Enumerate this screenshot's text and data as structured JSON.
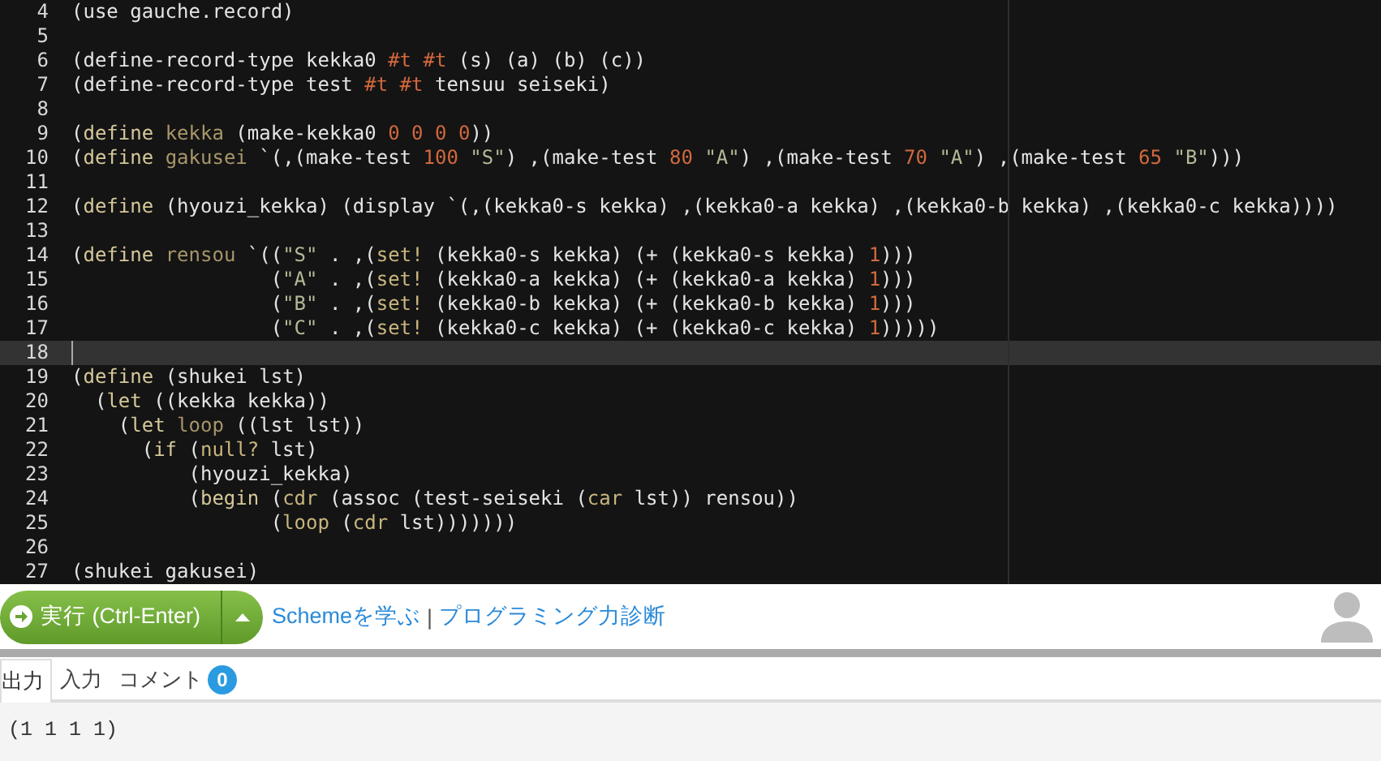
{
  "editor": {
    "lines": [
      {
        "number": "4",
        "active": false,
        "tokens": [
          {
            "text": "(use gauche.record)",
            "kind": "plain"
          }
        ]
      },
      {
        "number": "5",
        "active": false
      },
      {
        "number": "6",
        "active": false,
        "tokens": [
          {
            "text": "(define-record-type kekka0 ",
            "kind": "plain"
          },
          {
            "text": "#t #t",
            "kind": "number"
          },
          {
            "text": " (s) (a) (b) (c))",
            "kind": "plain"
          }
        ]
      },
      {
        "number": "7",
        "active": false,
        "tokens": [
          {
            "text": "(define-record-type test ",
            "kind": "plain"
          },
          {
            "text": "#t #t",
            "kind": "number"
          },
          {
            "text": " tensuu seiseki)",
            "kind": "plain"
          }
        ]
      },
      {
        "number": "8",
        "active": false
      },
      {
        "number": "9",
        "active": false,
        "tokens": [
          {
            "text": "(",
            "kind": "plain"
          },
          {
            "text": "define",
            "kind": "keyword"
          },
          {
            "text": " kekka",
            "kind": "name"
          },
          {
            "text": " (make-kekka0 ",
            "kind": "plain"
          },
          {
            "text": "0 0 0 0",
            "kind": "number"
          },
          {
            "text": "))",
            "kind": "plain"
          }
        ]
      },
      {
        "number": "10",
        "active": false,
        "tokens": [
          {
            "text": "(",
            "kind": "plain"
          },
          {
            "text": "define",
            "kind": "keyword"
          },
          {
            "text": " gakusei",
            "kind": "name"
          },
          {
            "text": " `(,(make-test ",
            "kind": "plain"
          },
          {
            "text": "100",
            "kind": "number"
          },
          {
            "text": " \"S\"",
            "kind": "string"
          },
          {
            "text": ") ,(make-test ",
            "kind": "plain"
          },
          {
            "text": "80",
            "kind": "number"
          },
          {
            "text": " \"A\"",
            "kind": "string"
          },
          {
            "text": ") ,(make-test ",
            "kind": "plain"
          },
          {
            "text": "70",
            "kind": "number"
          },
          {
            "text": " \"A\"",
            "kind": "string"
          },
          {
            "text": ") ,(make-test ",
            "kind": "plain"
          },
          {
            "text": "65",
            "kind": "number"
          },
          {
            "text": " \"B\"",
            "kind": "string"
          },
          {
            "text": ")))",
            "kind": "plain"
          }
        ]
      },
      {
        "number": "11",
        "active": false
      },
      {
        "number": "12",
        "active": false,
        "tokens": [
          {
            "text": "(",
            "kind": "plain"
          },
          {
            "text": "define",
            "kind": "keyword"
          },
          {
            "text": " (hyouzi_kekka) (display `(,(kekka0-s kekka) ,(kekka0-a kekka) ,(kekka0-b kekka) ,(kekka0-c kekka))))",
            "kind": "plain"
          }
        ]
      },
      {
        "number": "13",
        "active": false
      },
      {
        "number": "14",
        "active": false,
        "tokens": [
          {
            "text": "(",
            "kind": "plain"
          },
          {
            "text": "define",
            "kind": "keyword"
          },
          {
            "text": " rensou",
            "kind": "name"
          },
          {
            "text": " `((",
            "kind": "plain"
          },
          {
            "text": "\"S\"",
            "kind": "string"
          },
          {
            "text": " . ,(",
            "kind": "plain"
          },
          {
            "text": "set!",
            "kind": "builtin"
          },
          {
            "text": " (kekka0-s kekka) (+ (kekka0-s kekka) ",
            "kind": "plain"
          },
          {
            "text": "1",
            "kind": "number"
          },
          {
            "text": ")))",
            "kind": "plain"
          }
        ]
      },
      {
        "number": "15",
        "active": false,
        "tokens": [
          {
            "text": "                 (",
            "kind": "plain"
          },
          {
            "text": "\"A\"",
            "kind": "string"
          },
          {
            "text": " . ,(",
            "kind": "plain"
          },
          {
            "text": "set!",
            "kind": "builtin"
          },
          {
            "text": " (kekka0-a kekka) (+ (kekka0-a kekka) ",
            "kind": "plain"
          },
          {
            "text": "1",
            "kind": "number"
          },
          {
            "text": ")))",
            "kind": "plain"
          }
        ]
      },
      {
        "number": "16",
        "active": false,
        "tokens": [
          {
            "text": "                 (",
            "kind": "plain"
          },
          {
            "text": "\"B\"",
            "kind": "string"
          },
          {
            "text": " . ,(",
            "kind": "plain"
          },
          {
            "text": "set!",
            "kind": "builtin"
          },
          {
            "text": " (kekka0-b kekka) (+ (kekka0-b kekka) ",
            "kind": "plain"
          },
          {
            "text": "1",
            "kind": "number"
          },
          {
            "text": ")))",
            "kind": "plain"
          }
        ]
      },
      {
        "number": "17",
        "active": false,
        "tokens": [
          {
            "text": "                 (",
            "kind": "plain"
          },
          {
            "text": "\"C\"",
            "kind": "string"
          },
          {
            "text": " . ,(",
            "kind": "plain"
          },
          {
            "text": "set!",
            "kind": "builtin"
          },
          {
            "text": " (kekka0-c kekka) (+ (kekka0-c kekka) ",
            "kind": "plain"
          },
          {
            "text": "1",
            "kind": "number"
          },
          {
            "text": ")))))",
            "kind": "plain"
          }
        ]
      },
      {
        "number": "18",
        "active": true
      },
      {
        "number": "19",
        "active": false,
        "tokens": [
          {
            "text": "(",
            "kind": "plain"
          },
          {
            "text": "define",
            "kind": "keyword"
          },
          {
            "text": " (shukei lst)",
            "kind": "plain"
          }
        ]
      },
      {
        "number": "20",
        "active": false,
        "tokens": [
          {
            "text": "  (",
            "kind": "plain"
          },
          {
            "text": "let",
            "kind": "keyword"
          },
          {
            "text": " ((kekka kekka))",
            "kind": "plain"
          }
        ]
      },
      {
        "number": "21",
        "active": false,
        "tokens": [
          {
            "text": "    (",
            "kind": "plain"
          },
          {
            "text": "let",
            "kind": "keyword"
          },
          {
            "text": " loop",
            "kind": "name"
          },
          {
            "text": " ((lst lst))",
            "kind": "plain"
          }
        ]
      },
      {
        "number": "22",
        "active": false,
        "tokens": [
          {
            "text": "      (",
            "kind": "plain"
          },
          {
            "text": "if",
            "kind": "keyword"
          },
          {
            "text": " (",
            "kind": "plain"
          },
          {
            "text": "null?",
            "kind": "builtin"
          },
          {
            "text": " lst)",
            "kind": "plain"
          }
        ]
      },
      {
        "number": "23",
        "active": false,
        "tokens": [
          {
            "text": "          (hyouzi_kekka)",
            "kind": "plain"
          }
        ]
      },
      {
        "number": "24",
        "active": false,
        "tokens": [
          {
            "text": "          (",
            "kind": "plain"
          },
          {
            "text": "begin",
            "kind": "keyword"
          },
          {
            "text": " (",
            "kind": "plain"
          },
          {
            "text": "cdr",
            "kind": "builtin"
          },
          {
            "text": " (assoc (test-seiseki (",
            "kind": "plain"
          },
          {
            "text": "car",
            "kind": "builtin"
          },
          {
            "text": " lst)) rensou))",
            "kind": "plain"
          }
        ]
      },
      {
        "number": "25",
        "active": false,
        "tokens": [
          {
            "text": "                 (",
            "kind": "plain"
          },
          {
            "text": "loop",
            "kind": "builtin"
          },
          {
            "text": " (",
            "kind": "plain"
          },
          {
            "text": "cdr",
            "kind": "builtin"
          },
          {
            "text": " lst)))))))",
            "kind": "plain"
          }
        ]
      },
      {
        "number": "26",
        "active": false
      },
      {
        "number": "27",
        "active": false,
        "tokens": [
          {
            "text": "(shukei gakusei)",
            "kind": "plain"
          }
        ]
      }
    ]
  },
  "toolbar": {
    "run_button": "実行 (Ctrl-Enter)",
    "links": [
      {
        "text": "Schemeを学ぶ"
      },
      {
        "text": "プログラミング力診断"
      }
    ],
    "separator": "|"
  },
  "tabs": [
    {
      "label": "出力",
      "selected": true
    },
    {
      "label": "入力",
      "selected": false
    },
    {
      "label": "コメント",
      "selected": false,
      "badge": "0"
    }
  ],
  "output": "(1 1 1 1)"
}
